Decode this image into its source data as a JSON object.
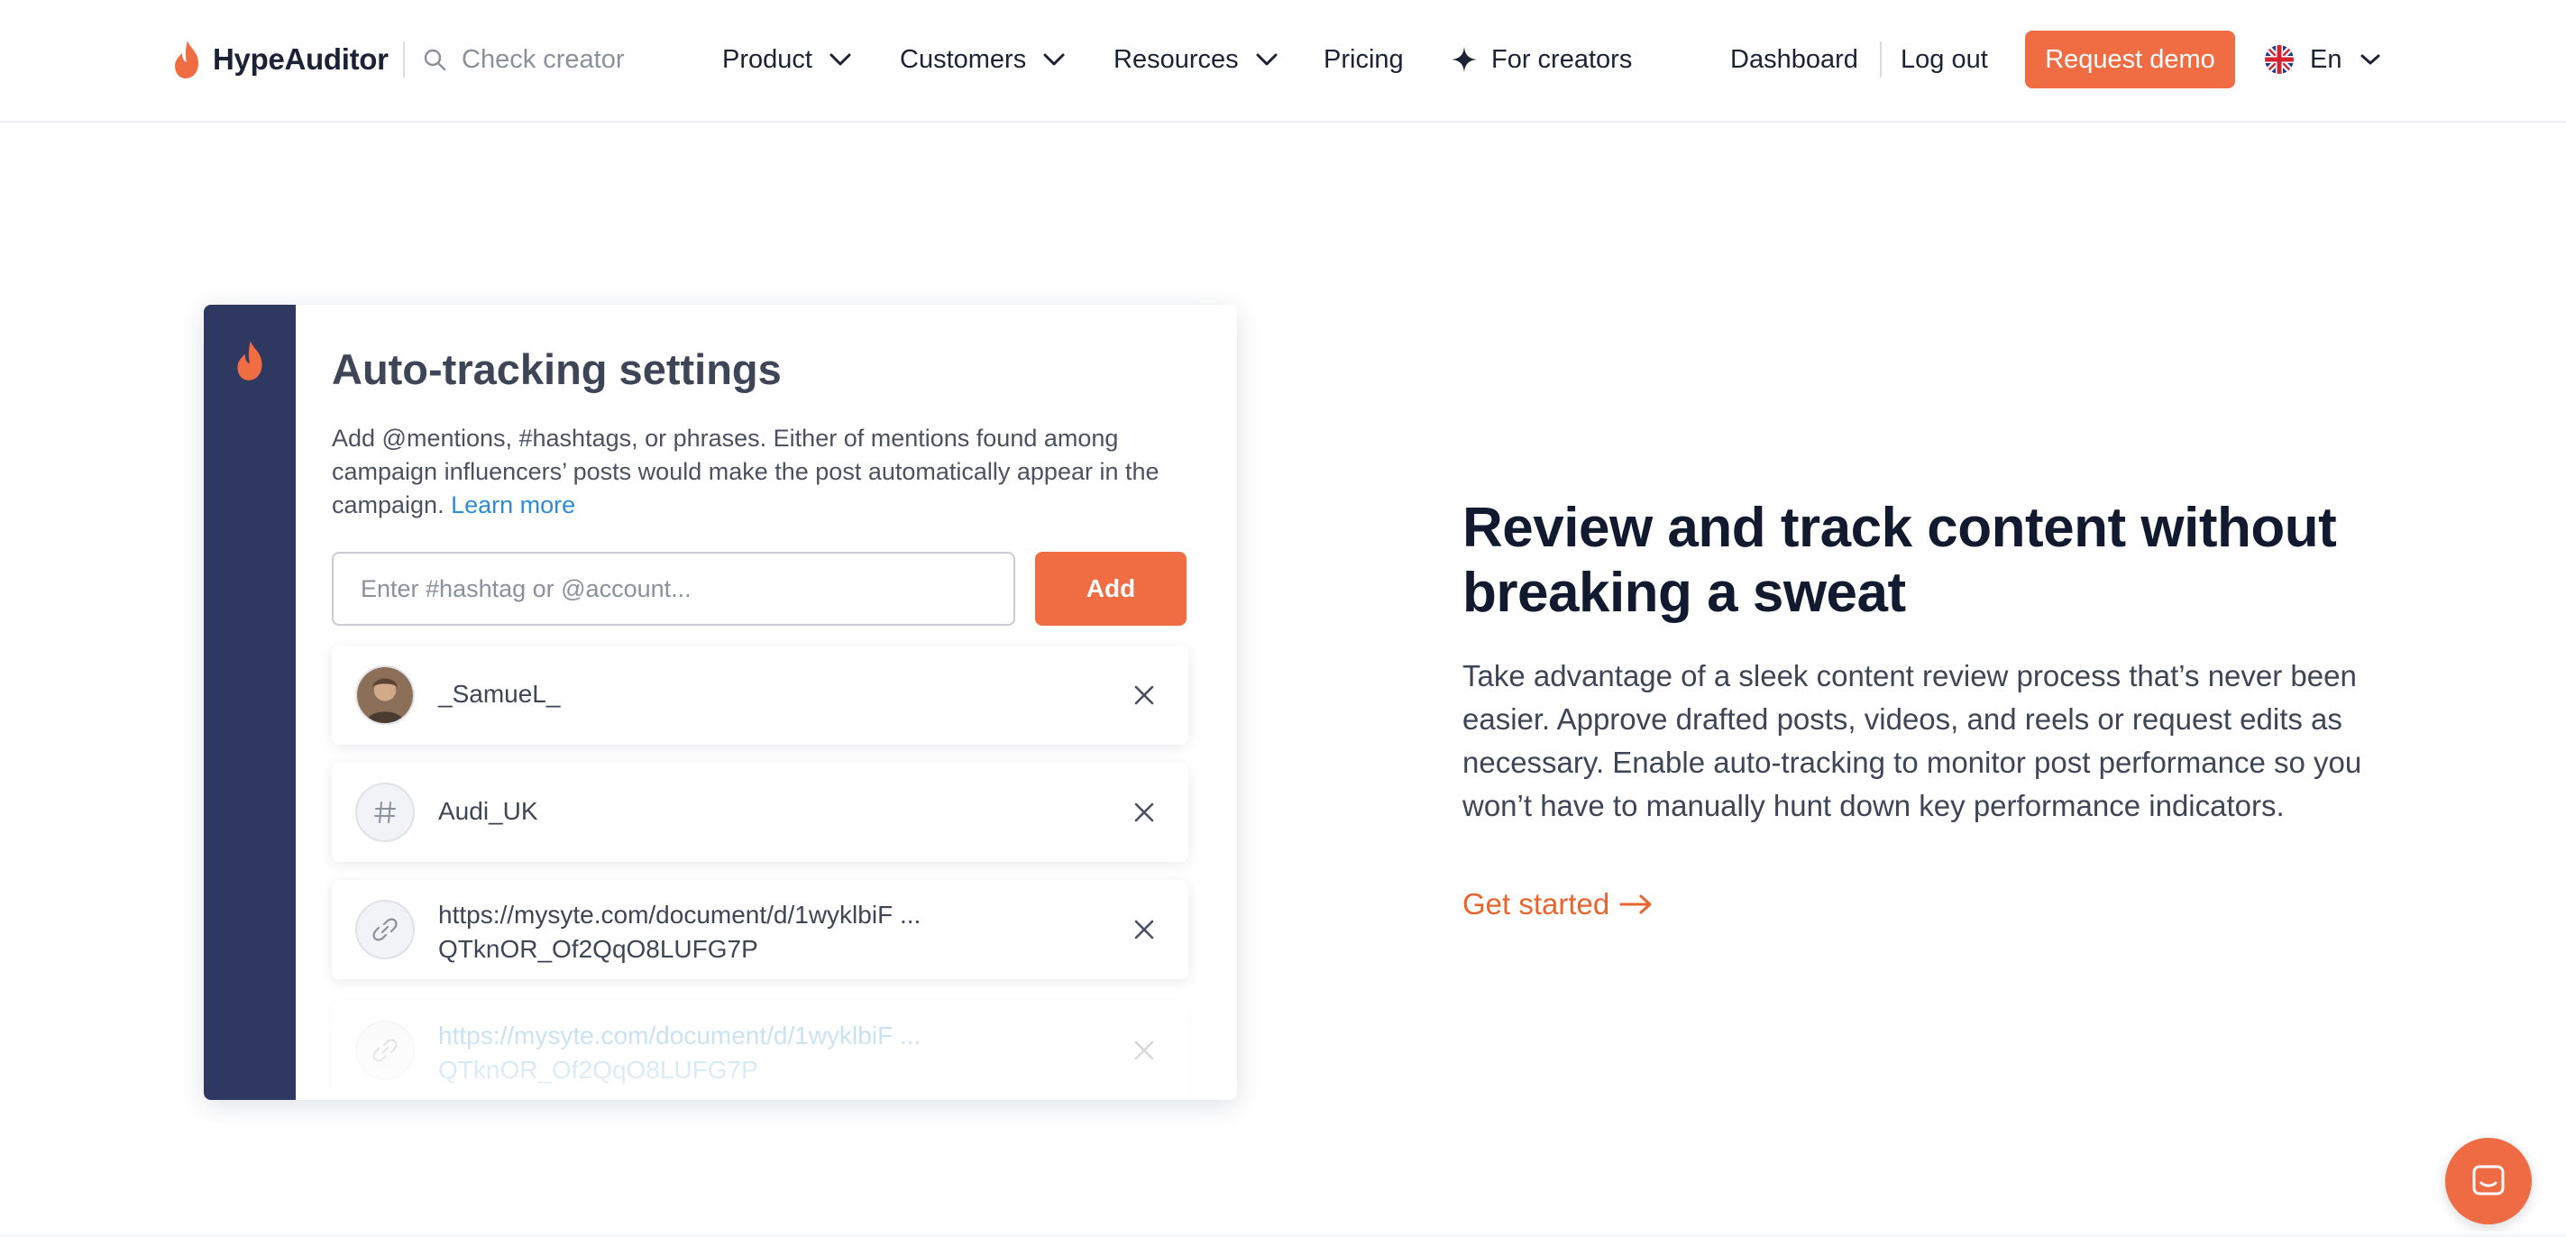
{
  "nav": {
    "brand": "HypeAuditor",
    "search_placeholder": "Check creator",
    "menu": [
      {
        "label": "Product"
      },
      {
        "label": "Customers"
      },
      {
        "label": "Resources"
      },
      {
        "label": "Pricing"
      },
      {
        "label": "For creators"
      }
    ],
    "dashboard": "Dashboard",
    "logout": "Log out",
    "request_demo": "Request demo",
    "language": "En"
  },
  "card": {
    "title": "Auto-tracking settings",
    "description": "Add @mentions, #hashtags, or phrases. Either of mentions found among campaign influencers’ posts would make the post automatically appear in the campaign.",
    "learn_more": "Learn more",
    "input_placeholder": "Enter #hashtag or @account...",
    "add_label": "Add",
    "items": [
      {
        "type": "account",
        "label": "_SamueL_"
      },
      {
        "type": "hashtag",
        "label": "Audi_UK"
      },
      {
        "type": "link",
        "line1": "https://mysyte.com/document/d/1wyklbiF ...",
        "line2": "QTknOR_Of2QqO8LUFG7P"
      },
      {
        "type": "link",
        "line1": "https://mysyte.com/document/d/1wyklbiF ...",
        "line2": "QTknOR_Of2QqO8LUFG7P"
      }
    ]
  },
  "hero": {
    "headline": "Review and track content without breaking a sweat",
    "body": "Take advantage of a sleek content review process that’s never been easier. Approve drafted posts, videos, and reels or request edits as necessary. Enable auto-tracking to monitor post performance so you won’t have to manually hunt down key performance indicators.",
    "cta": "Get started"
  },
  "colors": {
    "accent": "#f06d43",
    "sidebar": "#2f3861",
    "link": "#2e8bd4",
    "text_dark": "#121a30"
  },
  "icons": {
    "logo": "flame-icon",
    "search": "search-icon",
    "chevron": "chevron-down-icon",
    "creators": "sparkle-icon",
    "flag": "uk-flag-icon",
    "remove": "close-icon",
    "link": "link-icon",
    "hashtag": "hashtag-icon",
    "cta": "arrow-right-icon",
    "chat": "chat-icon"
  }
}
